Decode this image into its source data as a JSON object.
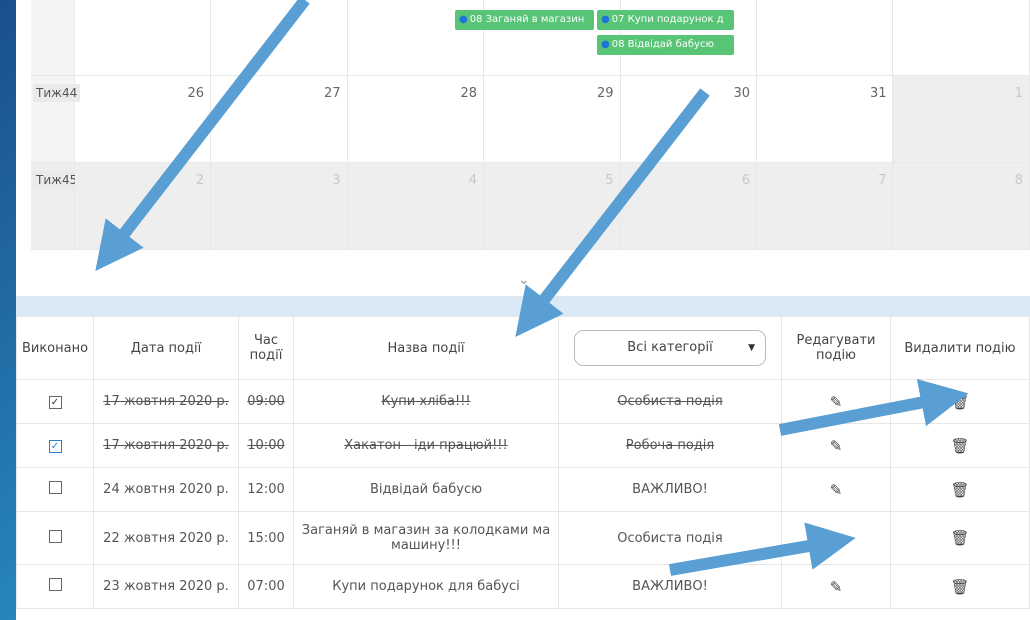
{
  "calendar": {
    "weeks": [
      {
        "label": "",
        "days": [
          {
            "num": "",
            "gray": false
          },
          {
            "num": "",
            "gray": false
          },
          {
            "num": "",
            "gray": false
          },
          {
            "num": "",
            "gray": false
          },
          {
            "num": "",
            "gray": false
          },
          {
            "num": "",
            "gray": false
          },
          {
            "num": "",
            "gray": false
          }
        ]
      },
      {
        "label": "Тиж44",
        "days": [
          {
            "num": "26",
            "gray": false
          },
          {
            "num": "27",
            "gray": false
          },
          {
            "num": "28",
            "gray": false
          },
          {
            "num": "29",
            "gray": false
          },
          {
            "num": "30",
            "gray": false
          },
          {
            "num": "31",
            "gray": false
          },
          {
            "num": "1",
            "gray": true
          }
        ]
      },
      {
        "label": "Тиж45",
        "days": [
          {
            "num": "2",
            "gray": true
          },
          {
            "num": "3",
            "gray": true
          },
          {
            "num": "4",
            "gray": true
          },
          {
            "num": "5",
            "gray": true
          },
          {
            "num": "6",
            "gray": true
          },
          {
            "num": "7",
            "gray": true
          },
          {
            "num": "8",
            "gray": true
          }
        ]
      }
    ],
    "events": [
      {
        "text": "08 Заганяй в магазин"
      },
      {
        "text": "07 Купи подарунок д"
      },
      {
        "text": "08  Відвідай бабусю"
      }
    ],
    "collapse_icon": "chevron-down-icon"
  },
  "table": {
    "headers": {
      "done": "Виконано",
      "date": "Дата події",
      "time": "Час події",
      "name": "Назва події",
      "category_select": "Всі категорії",
      "edit": "Редагувати подію",
      "delete": "Видалити подію"
    },
    "rows": [
      {
        "checked": true,
        "blue": false,
        "done": true,
        "date": "17 жовтня 2020 р.",
        "time": "09:00",
        "name": "Купи хліба!!!",
        "category": "Особиста подія"
      },
      {
        "checked": true,
        "blue": true,
        "done": true,
        "date": "17 жовтня 2020 р.",
        "time": "10:00",
        "name": "Хакатон - іди працюй!!!",
        "category": "Робоча подія"
      },
      {
        "checked": false,
        "blue": false,
        "done": false,
        "date": "24 жовтня 2020 р.",
        "time": "12:00",
        "name": "Відвідай бабусю",
        "category": "ВАЖЛИВО!"
      },
      {
        "checked": false,
        "blue": false,
        "done": false,
        "date": "22 жовтня 2020 р.",
        "time": "15:00",
        "name": "Заганяй в магазин за колодками ма машину!!!",
        "category": "Особиста подія"
      },
      {
        "checked": false,
        "blue": false,
        "done": false,
        "date": "23 жовтня 2020 р.",
        "time": "07:00",
        "name": "Купи подарунок для бабусі",
        "category": "ВАЖЛИВО!"
      }
    ],
    "edit_icon": "pencil-icon",
    "delete_icon": "trash-icon"
  },
  "colors": {
    "event_green": "#58c476",
    "arrow_blue": "#5a9fd4",
    "check_blue": "#2a7ed8"
  }
}
